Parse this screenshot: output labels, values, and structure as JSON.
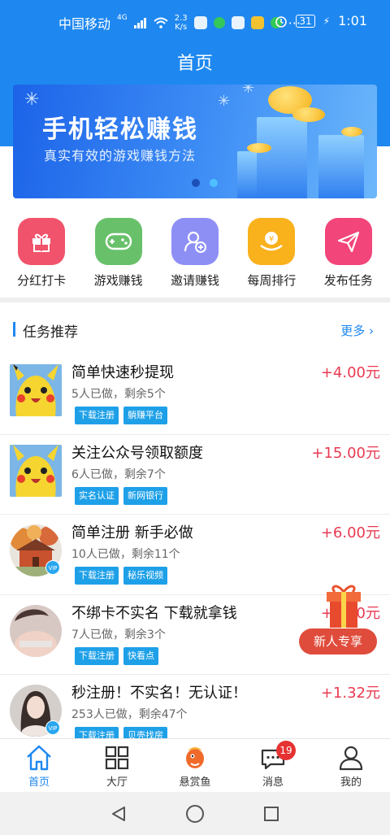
{
  "status_bar": {
    "carrier": "中国移动",
    "signal": "4G",
    "speed_top": "2.3",
    "speed_bottom": "K/s",
    "battery": "31",
    "time": "1:01"
  },
  "header": {
    "title": "首页"
  },
  "banner": {
    "title": "手机轻松赚钱",
    "subtitle": "真实有效的游戏赚钱方法",
    "pages": 2,
    "active_page": 2
  },
  "quick_actions": [
    {
      "label": "分红打卡",
      "icon": "gift-icon",
      "color": "#f0536b"
    },
    {
      "label": "游戏赚钱",
      "icon": "gamepad-icon",
      "color": "#68c16a"
    },
    {
      "label": "邀请赚钱",
      "icon": "invite-user-icon",
      "color": "#8e8ff5"
    },
    {
      "label": "每周排行",
      "icon": "coin-ranking-icon",
      "color": "#f9b11c"
    },
    {
      "label": "发布任务",
      "icon": "paper-plane-icon",
      "color": "#f2457a"
    }
  ],
  "section": {
    "title": "任务推荐",
    "more": "更多 ›"
  },
  "tasks": [
    {
      "title": "简单快速秒提现",
      "meta": "5人已做，剩余5个",
      "tags": [
        "下载注册",
        "躺赚平台"
      ],
      "reward": "+4.00元",
      "thumb": "pikachu"
    },
    {
      "title": "关注公众号领取额度",
      "meta": "6人已做，剩余7个",
      "tags": [
        "实名认证",
        "新网银行"
      ],
      "reward": "+15.00元",
      "thumb": "pikachu"
    },
    {
      "title": "简单注册 新手必做",
      "meta": "10人已做，剩余11个",
      "tags": [
        "下载注册",
        "秘乐视频"
      ],
      "reward": "+6.00元",
      "thumb": "autumn-house"
    },
    {
      "title": "不绑卡不实名 下载就拿钱",
      "meta": "7人已做，剩余3个",
      "tags": [
        "下载注册",
        "快看点"
      ],
      "reward": "+1.00元",
      "thumb": "portrait"
    },
    {
      "title": "秒注册！不实名！无认证！",
      "meta": "253人已做，剩余47个",
      "tags": [
        "下载注册",
        "贝壳找房"
      ],
      "reward": "+1.32元",
      "thumb": "portrait-girl"
    }
  ],
  "floating": {
    "newbie": "新人专享"
  },
  "bottom_nav": [
    {
      "label": "首页",
      "icon": "home-icon",
      "active": true
    },
    {
      "label": "大厅",
      "icon": "grid-icon"
    },
    {
      "label": "悬赏鱼",
      "icon": "fish-icon"
    },
    {
      "label": "消息",
      "icon": "message-icon",
      "badge": "19"
    },
    {
      "label": "我的",
      "icon": "profile-icon"
    }
  ]
}
